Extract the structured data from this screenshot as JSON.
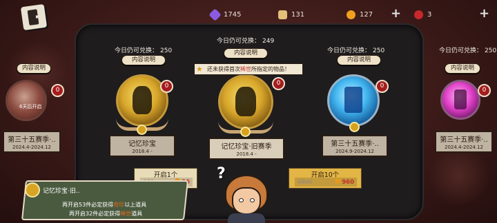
{
  "topbar": {
    "resources": [
      {
        "icon": "purple-gem-icon",
        "value": "1745",
        "color": "#8a5be0"
      },
      {
        "icon": "puzzle-piece-icon",
        "value": "131",
        "color": "#e3c07a"
      },
      {
        "icon": "gold-coin-icon",
        "value": "127",
        "color": "#f0a020"
      },
      {
        "icon": "red-ticket-icon",
        "value": "3",
        "color": "#c8282a"
      }
    ],
    "plus_label": "+"
  },
  "cards": [
    {
      "id": "far-left",
      "quota_label": "",
      "quota_value": "",
      "desc_label": "内容说明",
      "badge": "0",
      "title": "第三十五赛季·..",
      "date": "2024.4-2024.12",
      "lock_label": "6天后开启",
      "medal": "red"
    },
    {
      "id": "left",
      "quota_label": "今日仍可兑换：",
      "quota_value": "250",
      "desc_label": "内容说明",
      "badge": "0",
      "title": "记忆珍宝",
      "date": "2018.4 -",
      "medal": "gold"
    },
    {
      "id": "center",
      "quota_label": "今日仍可兑换：",
      "quota_value": "249",
      "desc_label": "内容说明",
      "badge": "0",
      "title": "记忆珍宝·旧赛季",
      "date": "2018.4 -",
      "medal": "gold"
    },
    {
      "id": "right",
      "quota_label": "今日仍可兑换：",
      "quota_value": "250",
      "desc_label": "内容说明",
      "badge": "0",
      "title": "第三十五赛季·..",
      "date": "2024.9-2024.12",
      "medal": "blue"
    },
    {
      "id": "far-right",
      "quota_label": "今日仍可兑换：",
      "quota_value": "250",
      "desc_label": "内容说明",
      "badge": "0",
      "title": "第三十五赛季·..",
      "date": "2024.4-2024.12",
      "medal": "pink"
    }
  ],
  "tooltip": {
    "prefix": "还未获得首次",
    "highlight": "稀世",
    "suffix": "所指定的物品！"
  },
  "open_buttons": [
    {
      "label": "开启1个",
      "old_price": "480",
      "price": "96"
    },
    {
      "label": "开启10个",
      "old_price": "4800",
      "price": "960"
    }
  ],
  "banner": {
    "label": "记忆珍宝·旧..",
    "line1_a": "再开启",
    "line1_num": "53",
    "line1_b": "件必定获得",
    "line1_hl": "奇珍",
    "line1_c": "以上道具",
    "line2_a": "再开启",
    "line2_num": "32",
    "line2_b": "件必定获得",
    "line2_hl": "稀世",
    "line2_c": "道具"
  },
  "girl": {
    "speech": "?"
  }
}
